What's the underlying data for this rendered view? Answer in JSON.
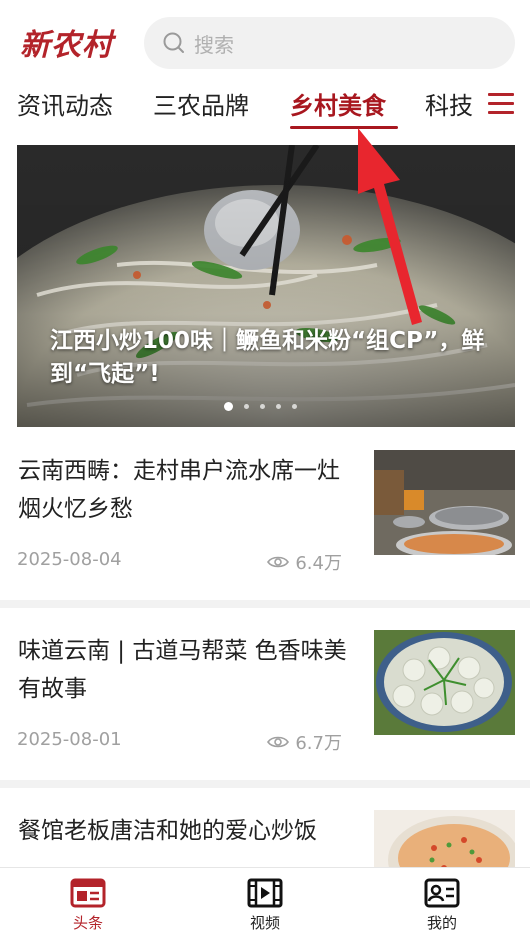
{
  "header": {
    "logo_text": "新农村",
    "search_placeholder": "搜索"
  },
  "tabs": [
    {
      "label": "资讯动态",
      "active": false
    },
    {
      "label": "三农品牌",
      "active": false
    },
    {
      "label": "乡村美食",
      "active": true
    },
    {
      "label": "科技",
      "active": false
    }
  ],
  "hero": {
    "title": "江西小炒100味｜鳜鱼和米粉“组CP”，鲜到“飞起”!",
    "slide_count": 5,
    "active_slide": 1
  },
  "articles": [
    {
      "title": "云南西畴：走村串户流水席一灶烟火忆乡愁",
      "date": "2025-08-04",
      "views": "6.4万"
    },
    {
      "title": "味道云南 | 古道马帮菜 色香味美有故事",
      "date": "2025-08-01",
      "views": "6.7万"
    },
    {
      "title": "餐馆老板唐洁和她的爱心炒饭",
      "date": "",
      "views": ""
    }
  ],
  "bottom_nav": [
    {
      "label": "头条",
      "icon": "news-icon",
      "active": true
    },
    {
      "label": "视频",
      "icon": "video-icon",
      "active": false
    },
    {
      "label": "我的",
      "icon": "profile-card-icon",
      "active": false
    }
  ],
  "colors": {
    "brand": "#b3232a",
    "active_tab": "#a8171f",
    "arrow": "#e8262e"
  }
}
